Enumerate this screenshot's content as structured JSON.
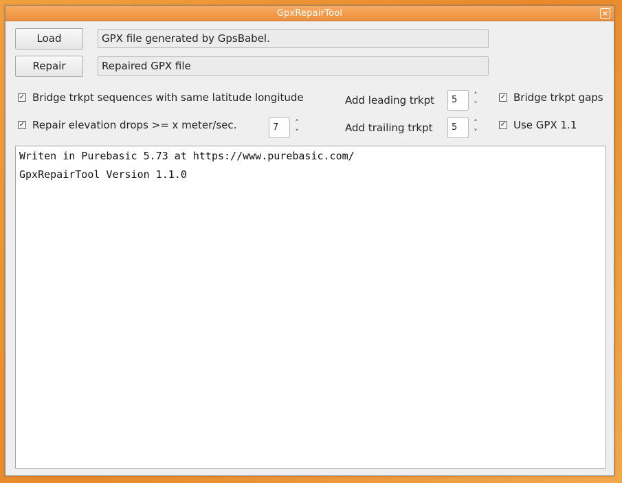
{
  "window": {
    "title": "GpxRepairTool"
  },
  "buttons": {
    "load": "Load",
    "repair": "Repair"
  },
  "fields": {
    "input_file": "GPX file generated by GpsBabel.",
    "output_file": "Repaired GPX file"
  },
  "options": {
    "bridge_same_latlon": {
      "label": "Bridge trkpt sequences with same latitude longitude",
      "checked": true
    },
    "repair_elevation": {
      "label": "Repair elevation drops >= x meter/sec.",
      "checked": true,
      "value": "7"
    },
    "add_leading": {
      "label": "Add leading trkpt",
      "value": "5"
    },
    "add_trailing": {
      "label": "Add trailing trkpt",
      "value": "5"
    },
    "bridge_gaps": {
      "label": "Bridge trkpt gaps",
      "checked": true
    },
    "use_gpx11": {
      "label": "Use GPX 1.1",
      "checked": true
    }
  },
  "log": {
    "lines": [
      "Writen in Purebasic 5.73 at https://www.purebasic.com/",
      "GpxRepairTool Version 1.1.0"
    ]
  },
  "glyphs": {
    "check": "✓",
    "close": "×",
    "up": "˄",
    "down": "˅"
  },
  "icons": {
    "close": "close-icon",
    "spin_up": "chevron-up-icon",
    "spin_down": "chevron-down-icon",
    "check": "checkmark-icon"
  },
  "colors": {
    "titlebar": "#f19a4a",
    "window_bg": "#efefef",
    "desktop": "#e8892a"
  }
}
